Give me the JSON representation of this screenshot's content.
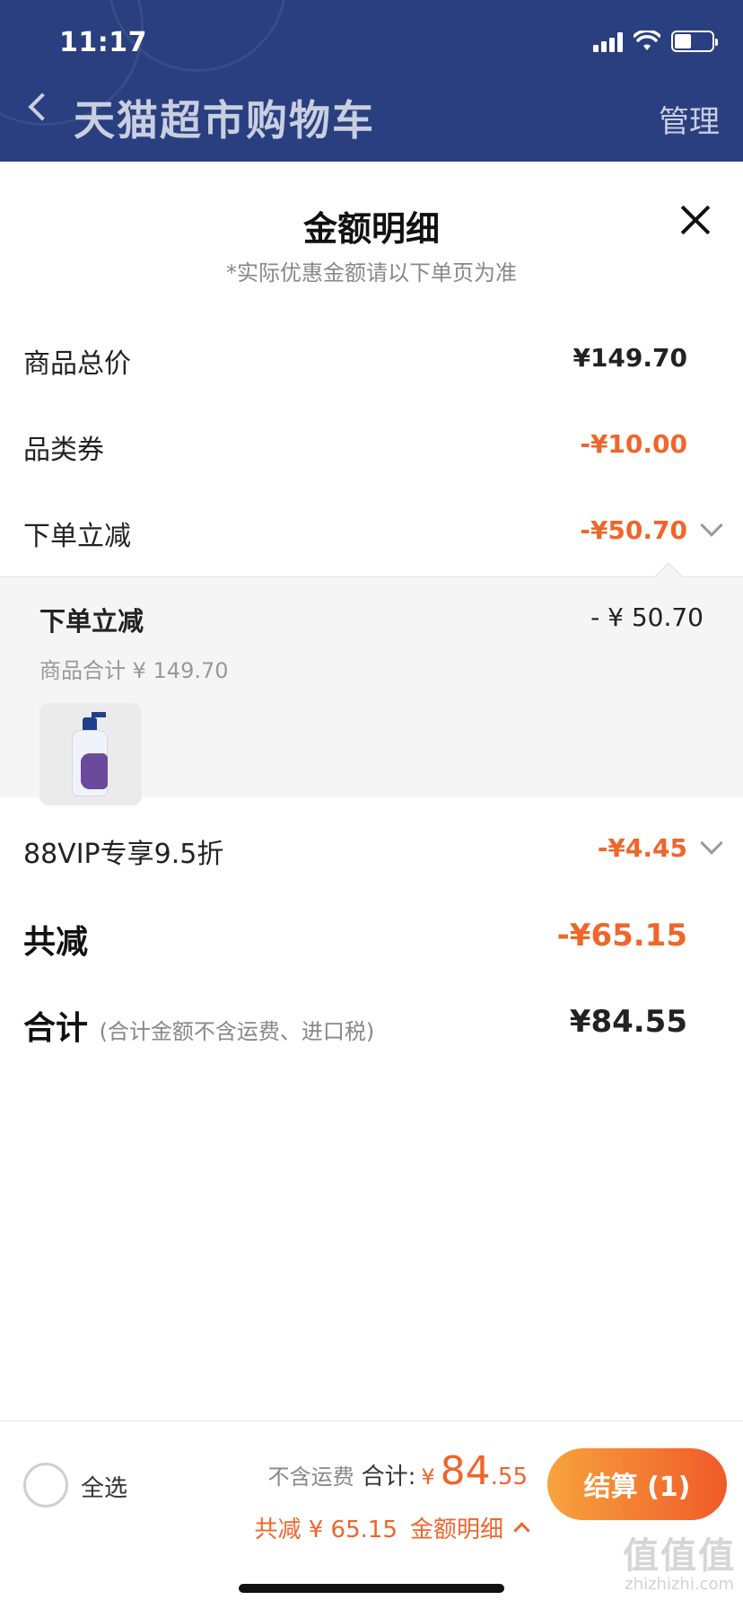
{
  "status": {
    "time": "11:17"
  },
  "nav": {
    "title": "天猫超市购物车",
    "manage": "管理"
  },
  "sheet": {
    "title": "金额明细",
    "subtitle": "*实际优惠金额请以下单页为准",
    "rows": {
      "goods_total": {
        "label": "商品总价",
        "value": "¥149.70"
      },
      "category_coupon": {
        "label": "品类券",
        "value": "-¥10.00"
      },
      "order_discount": {
        "label": "下单立减",
        "value": "-¥50.70"
      },
      "vip": {
        "label": "88VIP专享9.5折",
        "value": "-¥4.45"
      },
      "total_reduce": {
        "label": "共减",
        "value": "-¥65.15"
      },
      "grand_total": {
        "label": "合计",
        "note": "(合计金额不含运费、进口税)",
        "value": "¥84.55"
      }
    },
    "detail": {
      "title": "下单立减",
      "value": "- ¥ 50.70",
      "subtotal": "商品合计 ¥ 149.70"
    }
  },
  "bottom": {
    "select_all": "全选",
    "excl_shipping": "不含运费",
    "total_label": "合计:",
    "currency": "¥",
    "total_int": "84",
    "total_dec": ".55",
    "reduce_text": "共减 ¥ 65.15",
    "detail_link": "金额明细",
    "checkout": "结算 (1)"
  },
  "watermark": {
    "text": "值值值",
    "sub": "zhizhizhi.com"
  },
  "colors": {
    "header": "#2a3f7f",
    "accent": "#f0652a"
  }
}
